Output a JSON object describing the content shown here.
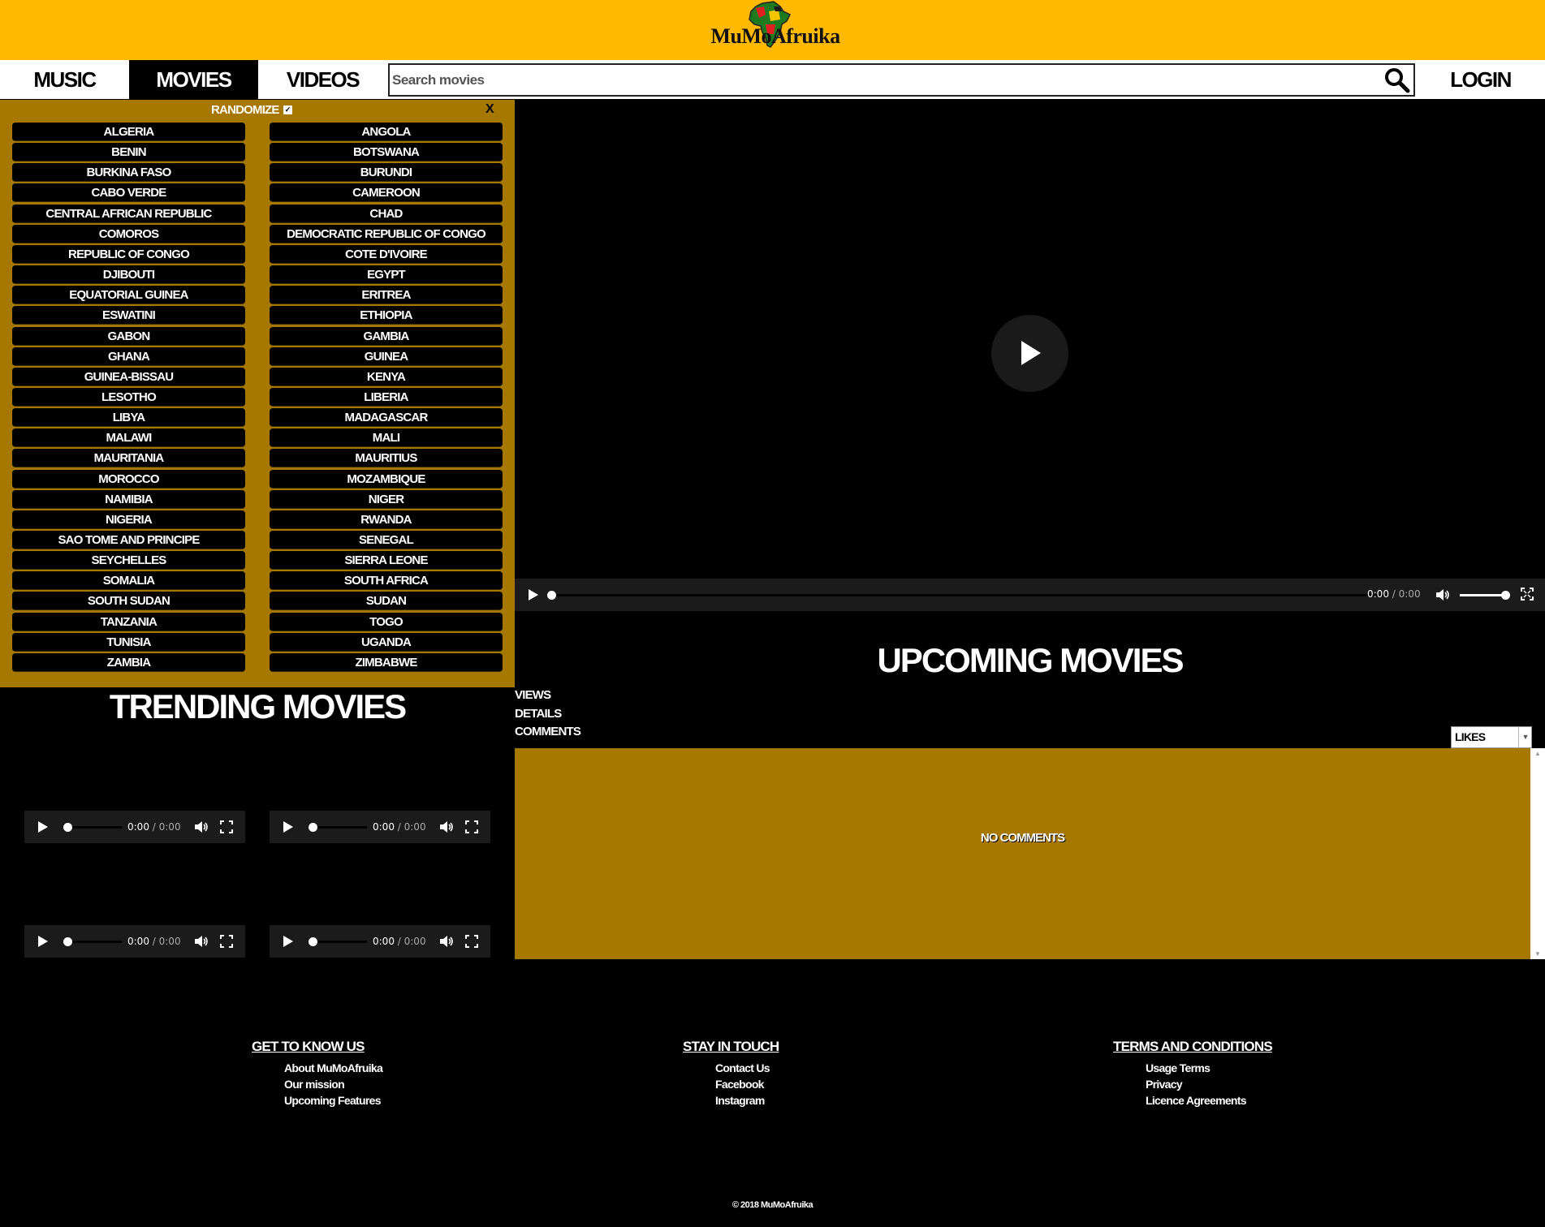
{
  "brand": {
    "logo_text": "MuMoAfruika"
  },
  "nav": {
    "tabs": [
      {
        "label": "MUSIC",
        "active": false
      },
      {
        "label": "MOVIES",
        "active": true
      },
      {
        "label": "VIDEOS",
        "active": false
      }
    ],
    "search": {
      "placeholder": "Search movies",
      "value": ""
    },
    "login_label": "LOGIN"
  },
  "country_panel": {
    "randomize_label": "RANDOMIZE",
    "randomize_checked": true,
    "close_label": "X",
    "left_column": [
      "ALGERIA",
      "BENIN",
      "BURKINA FASO",
      "CABO VERDE",
      "CENTRAL AFRICAN REPUBLIC",
      "COMOROS",
      "REPUBLIC OF CONGO",
      "DJIBOUTI",
      "EQUATORIAL GUINEA",
      "ESWATINI",
      "GABON",
      "GHANA",
      "GUINEA-BISSAU",
      "LESOTHO",
      "LIBYA",
      "MALAWI",
      "MAURITANIA",
      "MOROCCO",
      "NAMIBIA",
      "NIGERIA",
      "SAO TOME AND PRINCIPE",
      "SEYCHELLES",
      "SOMALIA",
      "SOUTH SUDAN",
      "TANZANIA",
      "TUNISIA",
      "ZAMBIA"
    ],
    "right_column": [
      "ANGOLA",
      "BOTSWANA",
      "BURUNDI",
      "CAMEROON",
      "CHAD",
      "DEMOCRATIC REPUBLIC OF CONGO",
      "COTE D'IVOIRE",
      "EGYPT",
      "ERITREA",
      "ETHIOPIA",
      "GAMBIA",
      "GUINEA",
      "KENYA",
      "LIBERIA",
      "MADAGASCAR",
      "MALI",
      "MAURITIUS",
      "MOZAMBIQUE",
      "NIGER",
      "RWANDA",
      "SENEGAL",
      "SIERRA LEONE",
      "SOUTH AFRICA",
      "SUDAN",
      "TOGO",
      "UGANDA",
      "ZIMBABWE"
    ]
  },
  "main_player": {
    "current_time": "0:00",
    "separator": " / ",
    "duration": "0:00",
    "progress_fraction": 0,
    "volume_fraction": 1
  },
  "upcoming": {
    "title": "UPCOMING MOVIES",
    "links": [
      "VIEWS",
      "DETAILS",
      "COMMENTS"
    ],
    "sort_selected": "LIKES",
    "no_comments_text": "NO COMMENTS"
  },
  "trending": {
    "title": "TRENDING MOVIES",
    "players": [
      {
        "current_time": "0:00",
        "duration": "0:00"
      },
      {
        "current_time": "0:00",
        "duration": "0:00"
      },
      {
        "current_time": "0:00",
        "duration": "0:00"
      },
      {
        "current_time": "0:00",
        "duration": "0:00"
      }
    ]
  },
  "footer": {
    "columns": [
      {
        "heading": "GET TO KNOW US",
        "links": [
          "About MuMoAfruika",
          "Our mission",
          "Upcoming Features"
        ]
      },
      {
        "heading": "STAY IN TOUCH",
        "links": [
          "Contact Us",
          "Facebook",
          "Instagram"
        ]
      },
      {
        "heading": "TERMS AND CONDITIONS",
        "links": [
          "Usage Terms",
          "Privacy",
          "Licence Agreements"
        ]
      }
    ],
    "copyright": "© 2018 MuMoAfruika"
  },
  "colors": {
    "header_bg": "#ffb900",
    "panel_bg": "#a67800",
    "page_bg": "#000000"
  },
  "icons": {
    "search": "search-icon",
    "play": "play-icon",
    "volume": "volume-icon",
    "fullscreen": "fullscreen-icon",
    "close": "close-icon"
  }
}
